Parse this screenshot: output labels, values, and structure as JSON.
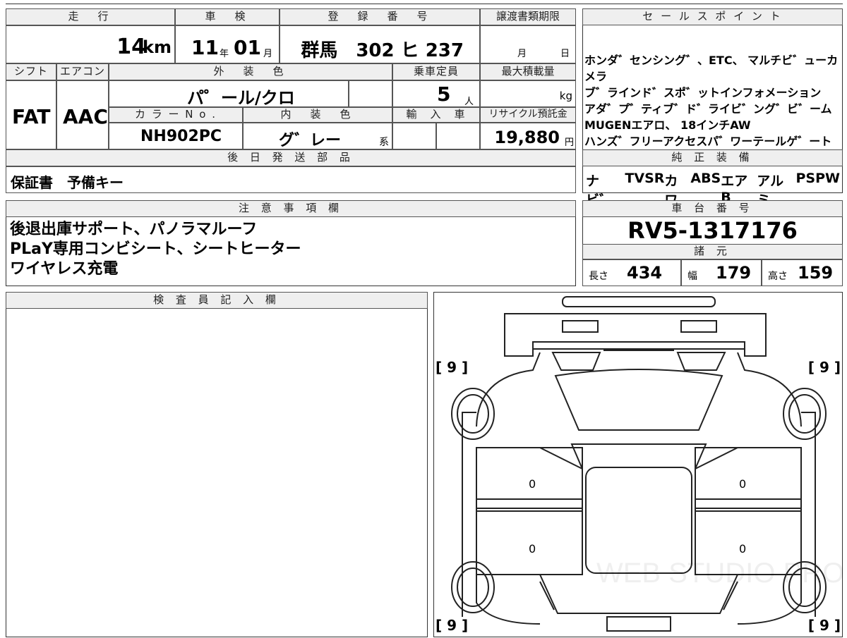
{
  "mileage": {
    "label": "走　行",
    "value": "14",
    "unit": "km"
  },
  "inspection": {
    "label": "車　検",
    "year": "11",
    "year_unit": "年",
    "month": "01",
    "month_unit": "月"
  },
  "registration": {
    "label": "登　録　番　号",
    "value": "群馬　302 ヒ 237"
  },
  "transfer_deadline": {
    "label": "譲渡書類期限",
    "month_unit": "月",
    "day_unit": "日"
  },
  "sales_points": {
    "label": "セ ー ル ス ポ イ ン ト",
    "items": [
      "ホンダ゛センシング゛、ETC、 マルチビ゛ューカメラ",
      "ブ゛ラインド゛スポ゛ットインフォメーション",
      "アダ゛プ゛ティブ゛ド゛ライビ゛ング゛ビ゛ーム",
      "MUGENエアロ、 18インチAW",
      "ハンズ゛フリーアクセスパ゛ワーテールゲ゛ート"
    ]
  },
  "shift": {
    "label": "シフト",
    "value": "FAT"
  },
  "aircon": {
    "label": "エアコン",
    "value": "AAC"
  },
  "exterior_color": {
    "label": "外　装　色",
    "value": "パ゜ール/クロ"
  },
  "capacity": {
    "label": "乗車定員",
    "value": "5",
    "unit": "人"
  },
  "max_load": {
    "label": "最大積載量",
    "unit": "kg"
  },
  "color_no": {
    "label": "カ ラ ー N o .",
    "value": "NH902PC"
  },
  "interior_color": {
    "label": "内　装　色",
    "value": "グ゛レー",
    "suffix": "系"
  },
  "import": {
    "label": "輸　入　車"
  },
  "recycle": {
    "label": "リサイクル預託金",
    "value": "19,880",
    "unit": "円"
  },
  "later_parts": {
    "label": "後 日 発 送 部 品",
    "value": "保証書　予備キー"
  },
  "genuine_equipment": {
    "label": "純 正 装 備",
    "items": [
      "ナビ゛",
      "TV",
      "SR",
      "カワ",
      "ABS",
      "エアB",
      "アルミ",
      "PS",
      "PW"
    ]
  },
  "notes": {
    "label": "注 意 事 項 欄",
    "lines": [
      "後退出庫サポート、パノラマルーフ",
      "PLaY専用コンビシート、シートヒーター",
      "ワイヤレス充電"
    ]
  },
  "chassis": {
    "label": "車 台 番 号",
    "value": "RV5-1317176"
  },
  "specs": {
    "label": "諸 元",
    "length_label": "長さ",
    "length": "434",
    "width_label": "幅",
    "width": "179",
    "height_label": "高さ",
    "height": "159"
  },
  "inspector": {
    "label": "検 査 員 記 入 欄"
  },
  "diagram": {
    "tire_marks": [
      "[ 9 ]",
      "[ 9 ]",
      "[ 9 ]",
      "[ 9 ]"
    ],
    "door_marks": [
      "0",
      "0",
      "0",
      "0"
    ],
    "watermark": "WEB STUDIO PRO"
  }
}
